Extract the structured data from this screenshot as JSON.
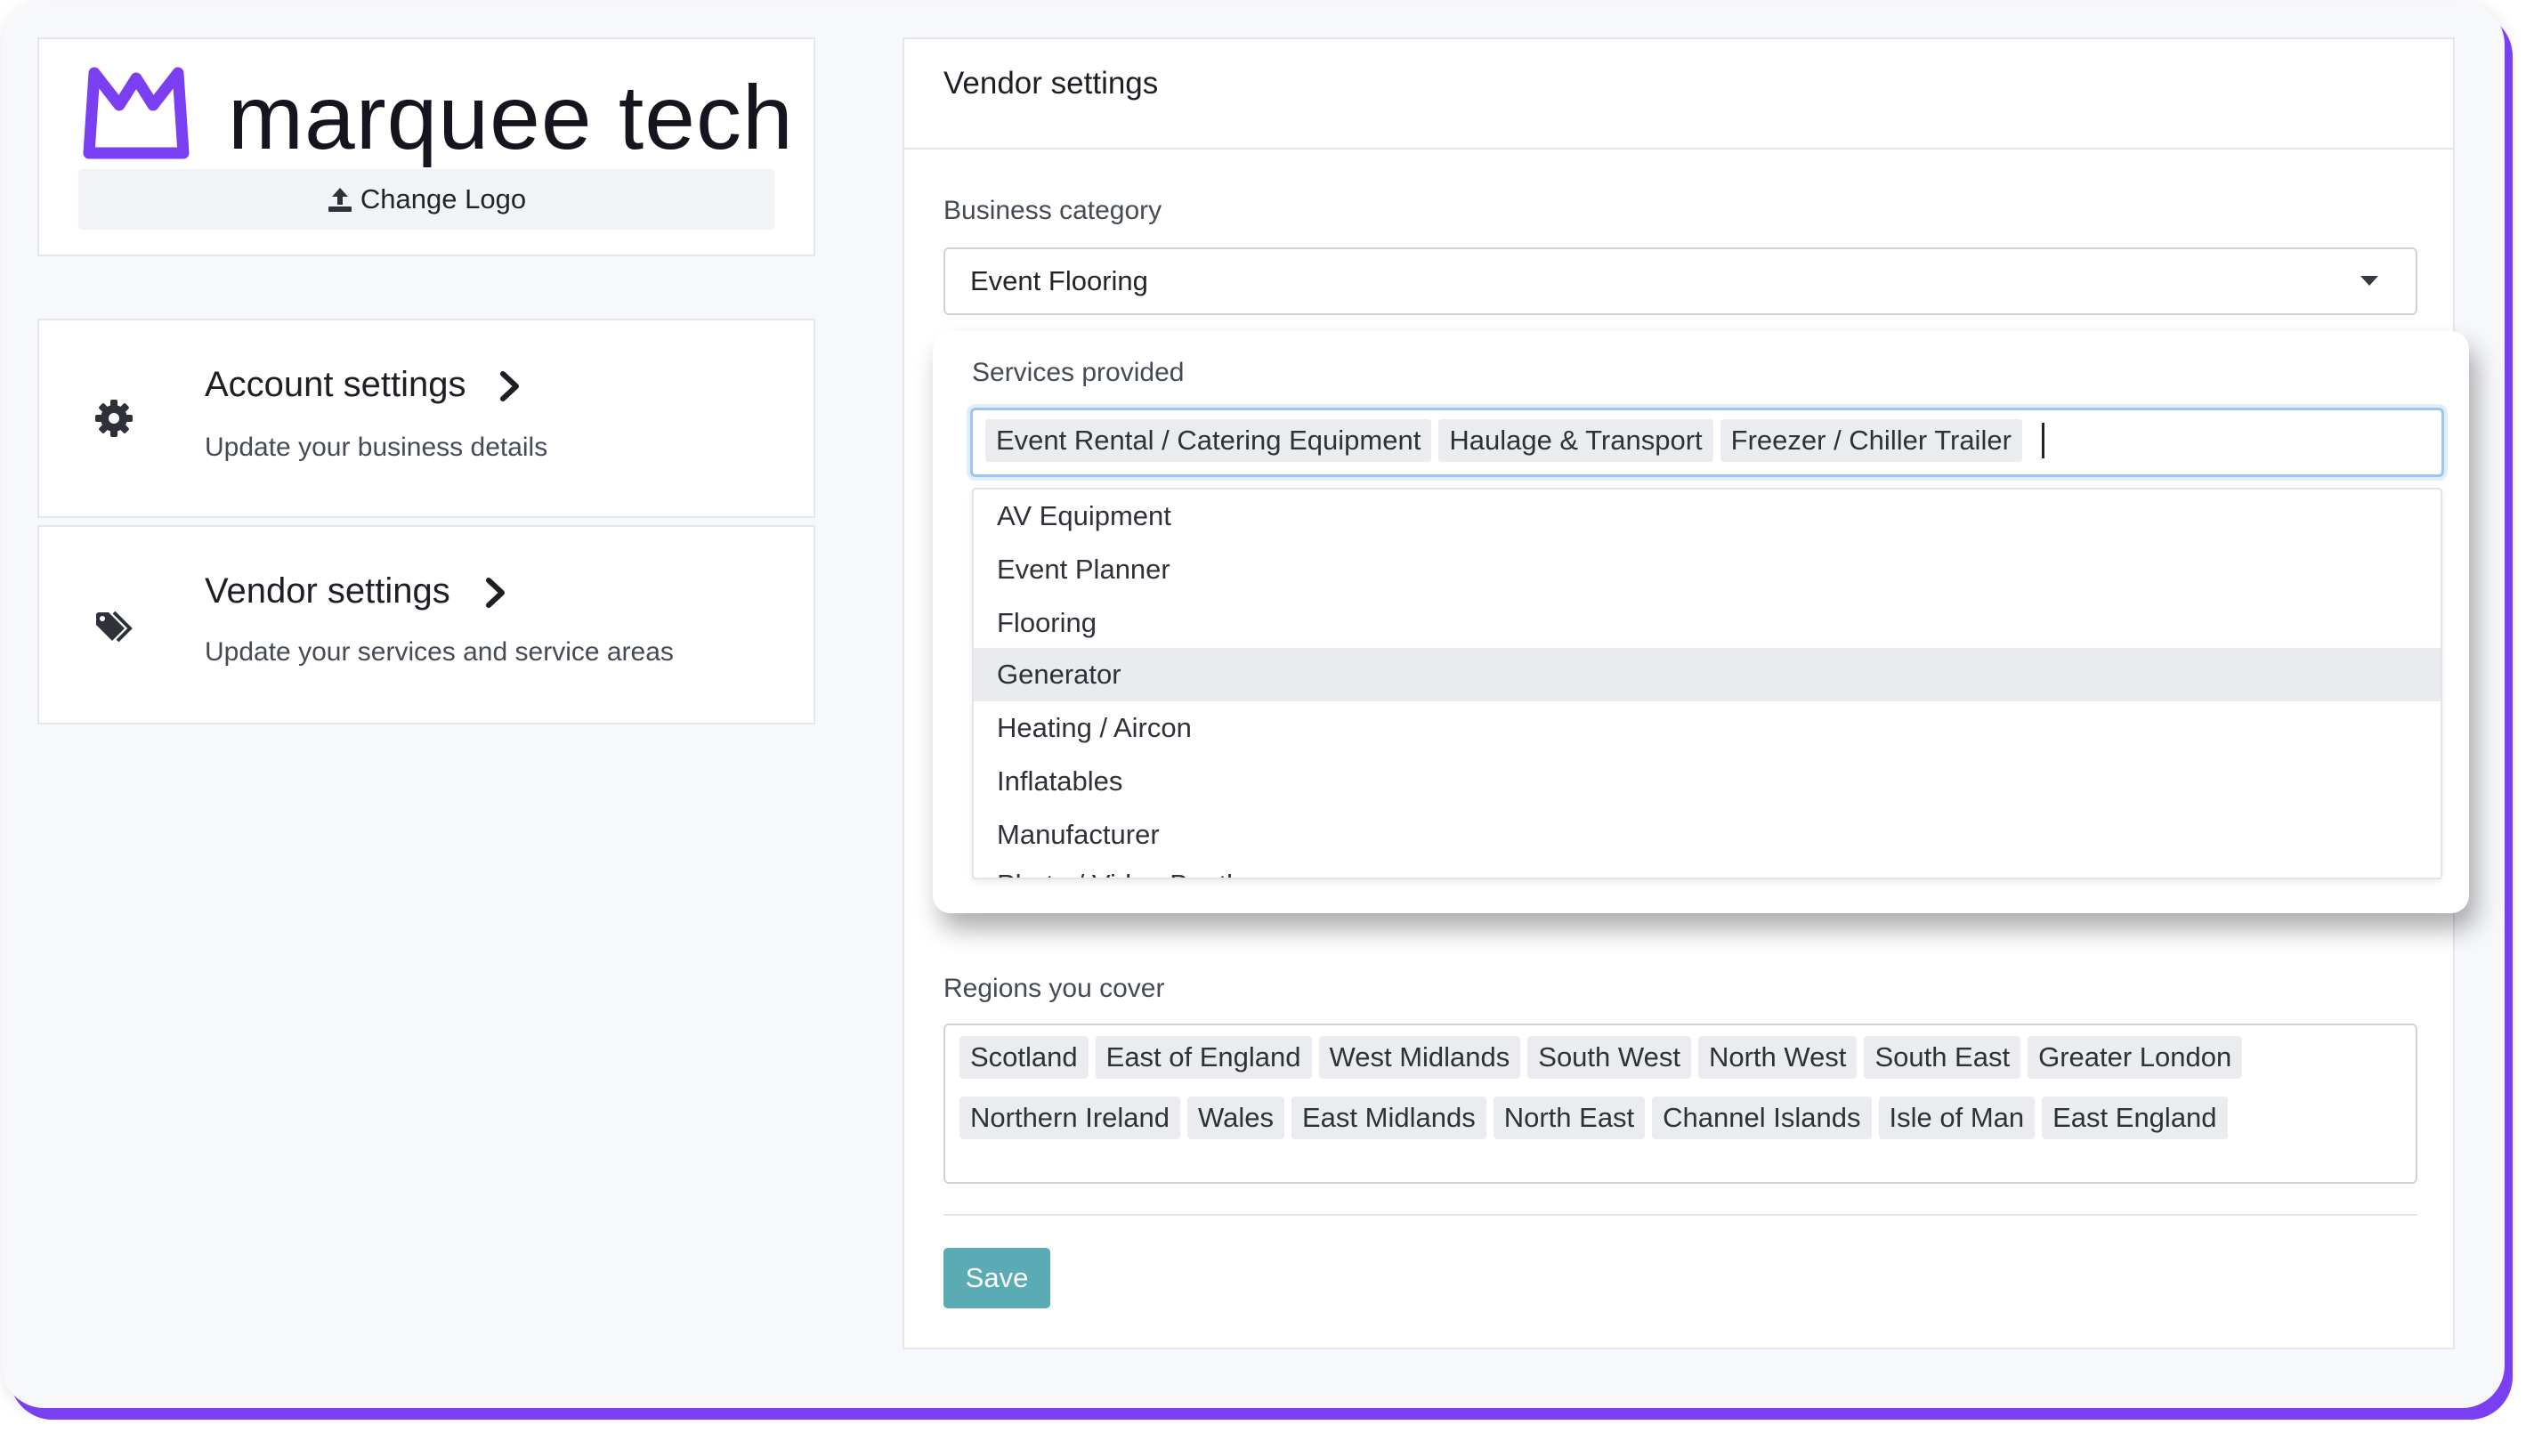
{
  "brand": {
    "name": "marquee tech",
    "change_logo_label": "Change Logo"
  },
  "menu": [
    {
      "title": "Account settings",
      "subtitle": "Update your business details",
      "icon": "gear-icon"
    },
    {
      "title": "Vendor settings",
      "subtitle": "Update your services and service areas",
      "icon": "tags-icon"
    }
  ],
  "vendor": {
    "title": "Vendor settings",
    "business_category_label": "Business category",
    "business_category_value": "Event Flooring",
    "services_label": "Services provided",
    "services_selected": [
      "Event Rental / Catering Equipment",
      "Haulage & Transport",
      "Freezer / Chiller Trailer"
    ],
    "services_options": [
      "AV Equipment",
      "Event Planner",
      "Flooring",
      "Generator",
      "Heating / Aircon",
      "Inflatables",
      "Manufacturer",
      "Photo / Video Booth"
    ],
    "services_highlighted": "Generator",
    "regions_label": "Regions you cover",
    "regions_row1": [
      "Scotland",
      "East of England",
      "West Midlands",
      "South West",
      "North West",
      "South East",
      "Greater London"
    ],
    "regions_row2": [
      "Northern Ireland",
      "Wales",
      "East Midlands",
      "North East",
      "Channel Islands",
      "Isle of Man",
      "East England"
    ],
    "save_label": "Save"
  },
  "colors": {
    "brand_purple": "#7b3ff2",
    "save_button": "#5aabb3",
    "focus_border": "#9cc4f4"
  }
}
